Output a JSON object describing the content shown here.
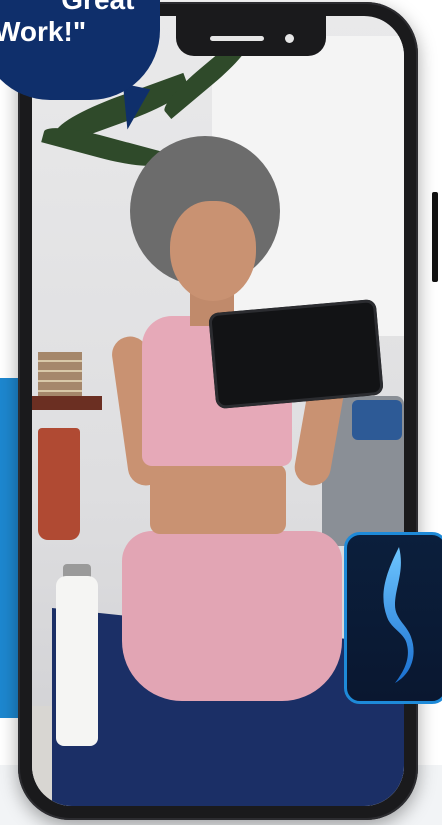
{
  "bubble": {
    "line1": "\"Great",
    "line2": "Work!\""
  },
  "colors": {
    "bubble": "#0f2f6b",
    "accent_panel": "#1d87cf",
    "icon_border": "#1e8ad8"
  },
  "icons": {
    "app_icon": "flame-logo-icon"
  }
}
